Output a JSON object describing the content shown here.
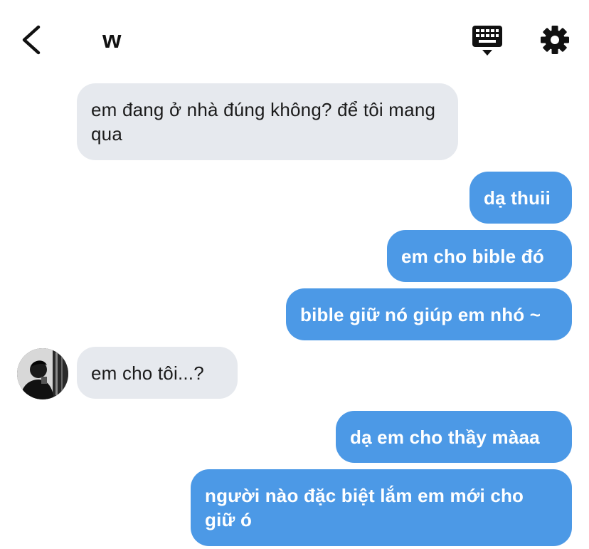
{
  "header": {
    "title": "w",
    "back_icon": "chevron-left-icon",
    "keyboard_icon": "keyboard-icon",
    "settings_icon": "gear-icon"
  },
  "colors": {
    "incoming_bubble": "#e6e9ee",
    "outgoing_bubble": "#4c99e6",
    "text_dark": "#1b1b1b",
    "text_light": "#ffffff"
  },
  "messages": [
    {
      "direction": "incoming",
      "text": "em đang ở nhà đúng không? để tôi mang qua"
    },
    {
      "direction": "outgoing",
      "text": "dạ thuii"
    },
    {
      "direction": "outgoing",
      "text": "em cho bible đó"
    },
    {
      "direction": "outgoing",
      "text": "bible giữ nó giúp em nhó ~"
    },
    {
      "direction": "incoming",
      "text": "em cho tôi...?",
      "has_avatar": true
    },
    {
      "direction": "outgoing",
      "text": "dạ em cho thầy màaa"
    },
    {
      "direction": "outgoing",
      "text": "người nào đặc biệt lắm em mới cho giữ ó"
    }
  ]
}
